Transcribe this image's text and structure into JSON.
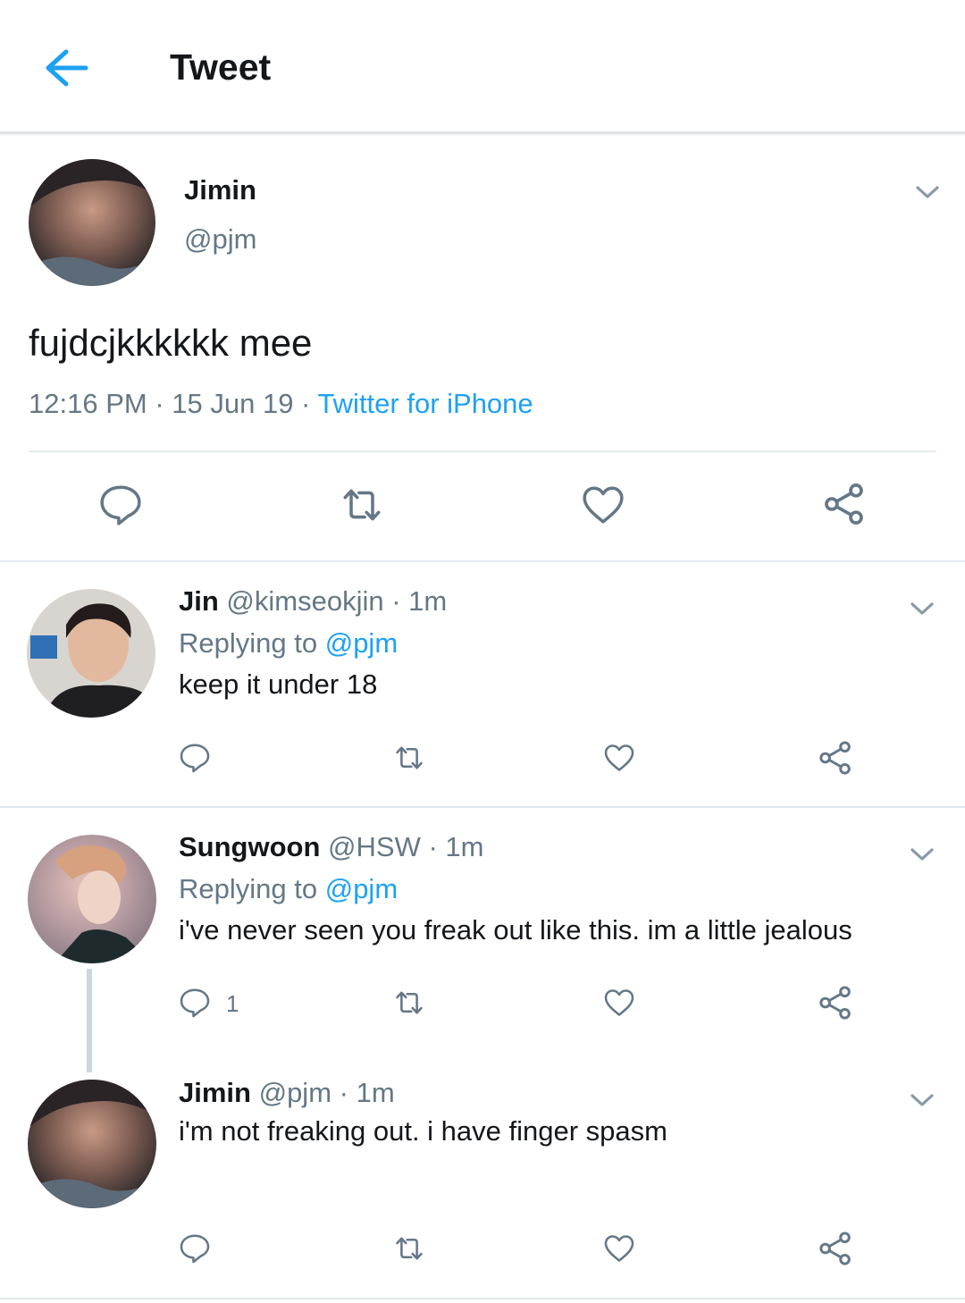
{
  "header": {
    "title": "Tweet"
  },
  "main_tweet": {
    "name": "Jimin",
    "handle": "@pjm",
    "text": "fujdcjkkkkkk mee",
    "time": "12:16 PM",
    "date": "15 Jun 19",
    "source": "Twitter for iPhone"
  },
  "replies": [
    {
      "name": "Jin",
      "handle": "@kimseokjin",
      "age": "1m",
      "replying_prefix": "Replying to",
      "replying_to": "@pjm",
      "text": "keep it under 18",
      "reply_count": ""
    },
    {
      "name": "Sungwoon",
      "handle": "@HSW",
      "age": "1m",
      "replying_prefix": "Replying to",
      "replying_to": "@pjm",
      "text": "i've never seen you freak out like this. im a little jealous",
      "reply_count": "1"
    },
    {
      "name": "Jimin",
      "handle": "@pjm",
      "age": "1m",
      "text": "i'm not freaking out. i have finger spasm",
      "reply_count": ""
    }
  ],
  "separator": " · ",
  "icons": [
    "back-arrow-icon",
    "chevron-down-icon",
    "reply-icon",
    "retweet-icon",
    "like-icon",
    "share-icon"
  ],
  "colors": {
    "accent": "#1da1f2",
    "secondary_text": "#657786",
    "icon": "#657786"
  }
}
